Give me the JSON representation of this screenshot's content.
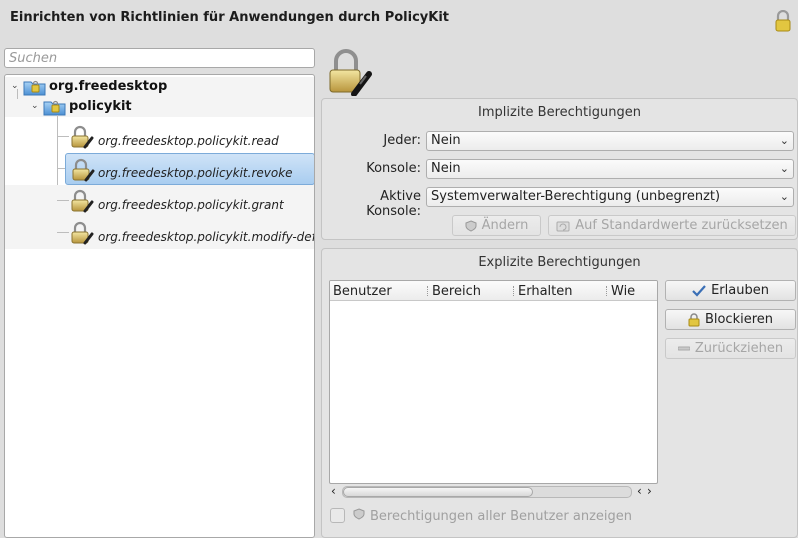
{
  "window": {
    "title": "Einrichten von Richtlinien für Anwendungen durch PolicyKit",
    "title_icon": "padlock-icon"
  },
  "search": {
    "placeholder": "Suchen",
    "value": ""
  },
  "tree": {
    "root": {
      "label": "org.freedesktop",
      "icon": "folder-lock-icon",
      "expanded": true
    },
    "child": {
      "label": "policykit",
      "icon": "folder-lock-icon",
      "expanded": true
    },
    "actions": [
      {
        "label": "org.freedesktop.policykit.read",
        "icon": "padlock-icon",
        "selected": false
      },
      {
        "label": "org.freedesktop.policykit.revoke",
        "icon": "padlock-icon",
        "selected": true
      },
      {
        "label": "org.freedesktop.policykit.grant",
        "icon": "padlock-icon",
        "selected": false
      },
      {
        "label": "org.freedesktop.policykit.modify-defau",
        "icon": "padlock-icon",
        "selected": false
      }
    ]
  },
  "implicit": {
    "title": "Implizite Berechtigungen",
    "rows": [
      {
        "label": "Jeder:",
        "value": "Nein"
      },
      {
        "label": "Konsole:",
        "value": "Nein"
      },
      {
        "label": "Aktive Konsole:",
        "value": "Systemverwalter-Berechtigung (unbegrenzt)"
      }
    ],
    "change_button": "Ändern",
    "reset_button": "Auf Standardwerte zurücksetzen"
  },
  "explicit": {
    "title": "Explizite Berechtigungen",
    "columns": [
      "Benutzer",
      "Bereich",
      "Erhalten",
      "Wie"
    ],
    "rows": [],
    "allow_button": "Erlauben",
    "block_button": "Blockieren",
    "revoke_button": "Zurückziehen",
    "show_all_label": "Berechtigungen aller Benutzer anzeigen",
    "show_all_checked": false
  },
  "colors": {
    "selection": "#a9cdf0",
    "window_bg": "#dedede",
    "disabled_text": "#a6a6a6"
  }
}
